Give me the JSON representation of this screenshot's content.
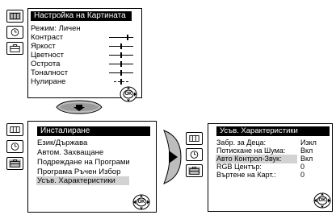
{
  "picture_menu": {
    "title": "Настройка на Картината",
    "mode_label": "Режим:",
    "mode_value": "Личен",
    "items": [
      {
        "label": "Контраст",
        "level": 0.78
      },
      {
        "label": "Яркост",
        "level": 0.5
      },
      {
        "label": "Цветност",
        "level": 0.5
      },
      {
        "label": "Острота",
        "level": 0.5
      },
      {
        "label": "Тоналност",
        "level": 0.5
      },
      {
        "label": "Нулиране",
        "level": 0.5
      }
    ],
    "ok_label": "OK"
  },
  "install_menu": {
    "title": "Инсталиране",
    "items": [
      "Език/Държава",
      "Автом. Захващане",
      "Подреждане на Програми",
      "Програма Ръчен Избор",
      "Усъв. Характеристики"
    ],
    "ok_label": "OK"
  },
  "advanced_menu": {
    "title": "Усъв. Характеристики",
    "items": [
      {
        "label": "Забр. за Деца:",
        "value": "Изкл"
      },
      {
        "label": "Потискане на Шума:",
        "value": "Вкл"
      },
      {
        "label": "Авто Контрол-Звук:",
        "value": "Вкл"
      },
      {
        "label": "RGB Център:",
        "value": "0"
      },
      {
        "label": "Въртене на Карт.:",
        "value": "0"
      }
    ],
    "ok_label": "OK"
  }
}
